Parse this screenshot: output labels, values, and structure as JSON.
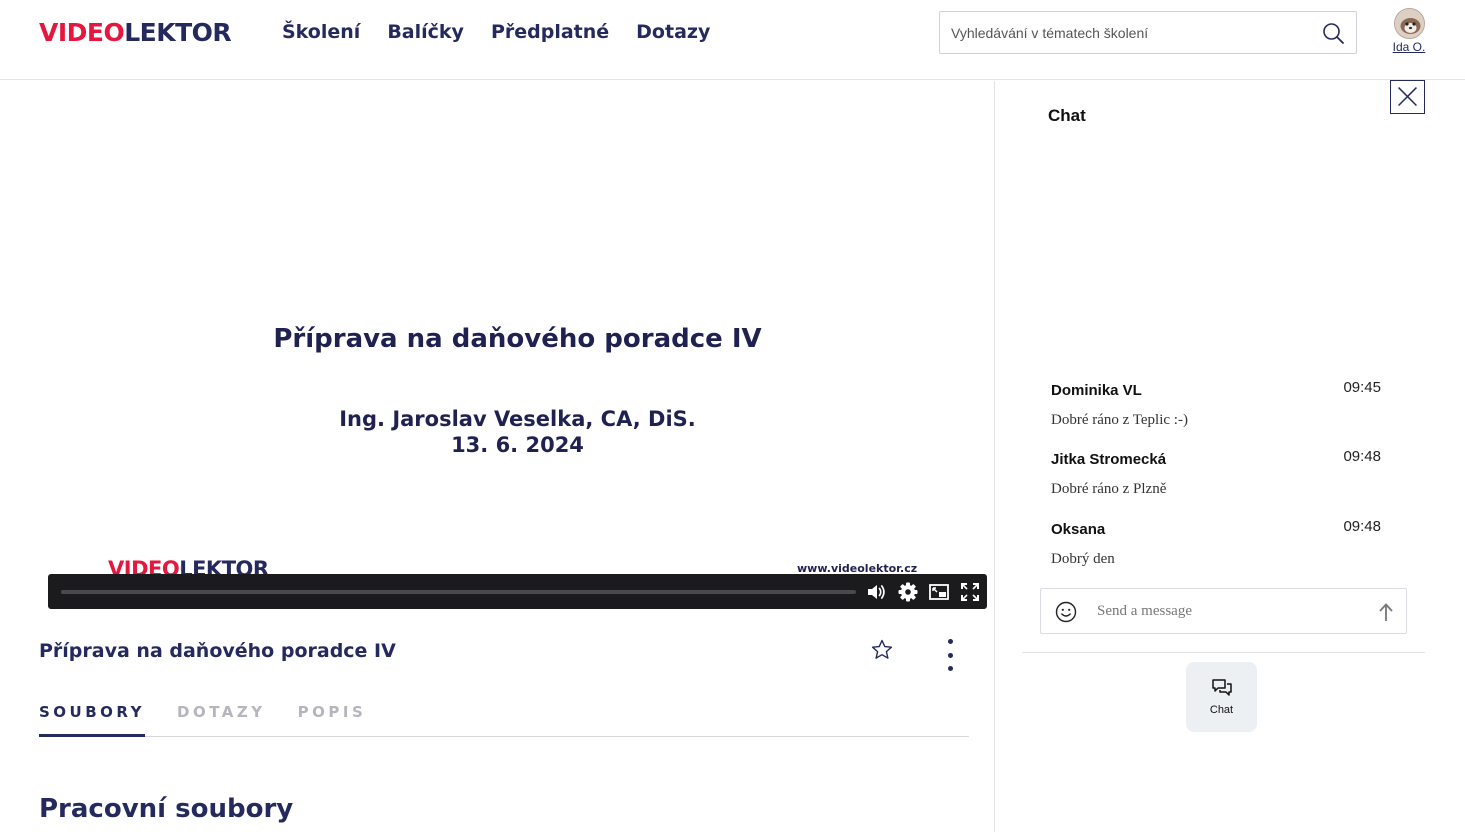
{
  "header": {
    "logo": {
      "part1": "VIDEO",
      "part2": "LEKTOR"
    },
    "nav": [
      {
        "label": "Školení"
      },
      {
        "label": "Balíčky"
      },
      {
        "label": "Předplatné"
      },
      {
        "label": "Dotazy"
      }
    ],
    "search": {
      "placeholder": "Vyhledávání v tématech školení",
      "value": "",
      "icon": "search-icon"
    },
    "user": {
      "name": "Ida O.",
      "icon": "avatar"
    }
  },
  "video": {
    "slide": {
      "title": "Příprava na daňového poradce IV",
      "author": "Ing. Jaroslav Veselka, CA, DiS.",
      "date": "13. 6. 2024",
      "logo_part1": "VIDEO",
      "logo_part2": "LEKTOR",
      "url": "www.videolektor.cz"
    },
    "controls": {
      "progress_fraction": 0.0,
      "icons": [
        "volume-icon",
        "settings-gear-icon",
        "picture-in-picture-icon",
        "fullscreen-icon"
      ]
    }
  },
  "course": {
    "title": "Příprava na daňového poradce IV",
    "tabs": [
      {
        "label": "SOUBORY",
        "active": true
      },
      {
        "label": "DOTAZY",
        "active": false
      },
      {
        "label": "POPIS",
        "active": false
      }
    ],
    "section_title": "Pracovní soubory"
  },
  "chat": {
    "title": "Chat",
    "messages": [
      {
        "author": "Dominika VL",
        "time": "09:45",
        "text": "Dobré ráno z Teplic :-)"
      },
      {
        "author": "Jitka Stromecká",
        "time": "09:48",
        "text": "Dobré ráno z Plzně"
      },
      {
        "author": "Oksana",
        "time": "09:48",
        "text": "Dobrý den"
      }
    ],
    "input": {
      "placeholder": "Send a message",
      "value": ""
    },
    "toggle_label": "Chat"
  },
  "colors": {
    "brand_navy": "#242a5e",
    "brand_red": "#e5173f",
    "controls_bg": "#1b1b1d"
  }
}
